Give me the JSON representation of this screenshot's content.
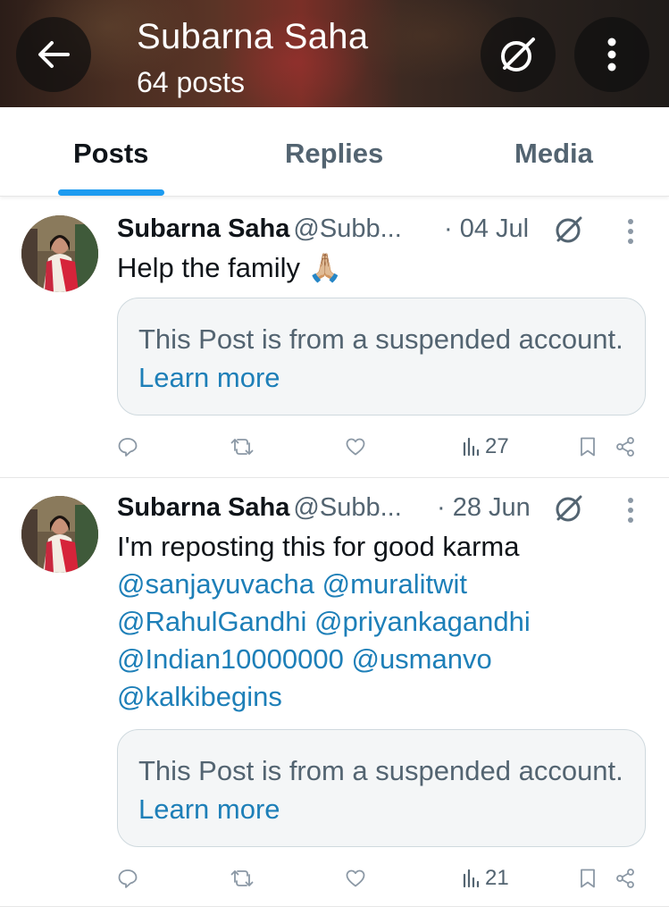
{
  "header": {
    "name": "Subarna Saha",
    "post_count": "64 posts",
    "back_icon": "arrow-left-icon",
    "grok_icon": "grok-icon",
    "more_icon": "more-vertical-icon"
  },
  "tabs": [
    {
      "label": "Posts",
      "active": true
    },
    {
      "label": "Replies",
      "active": false
    },
    {
      "label": "Media",
      "active": false
    }
  ],
  "colors": {
    "accent": "#1d9bf0",
    "link": "#1d7fb8",
    "secondary_text": "#536471"
  },
  "posts": [
    {
      "display_name": "Subarna Saha",
      "handle": "@Subb...",
      "date": "· 04 Jul",
      "text": "Help the family 🙏🏼",
      "mentions": [],
      "notice_text": "This Post is from a suspended account.",
      "notice_link": "Learn more",
      "views": "27"
    },
    {
      "display_name": "Subarna Saha",
      "handle": "@Subb...",
      "date": "· 28 Jun",
      "text": "I'm reposting this for good karma",
      "mention_lines": [
        "@sanjayuvacha @muralitwit",
        "@RahulGandhi @priyankagandhi",
        "@Indian10000000 @usmanvo",
        "@kalkibegins"
      ],
      "notice_text": "This Post is from a suspended account.",
      "notice_link": "Learn more",
      "views": "21"
    }
  ]
}
